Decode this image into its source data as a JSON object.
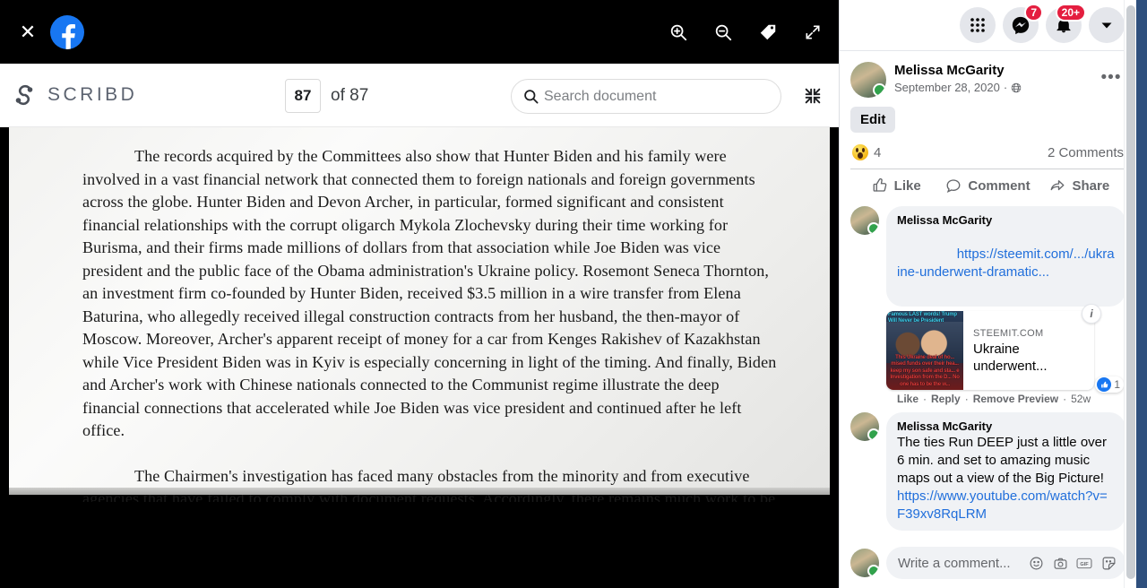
{
  "viewer": {
    "close_label": "✕",
    "brand_icon": "facebook-icon",
    "logo_text": "SCRIBD",
    "page_current": "87",
    "page_of": "of 87",
    "search_placeholder": "Search document",
    "icons": {
      "zoom_in": "zoom-in-icon",
      "zoom_out": "zoom-out-icon",
      "tag": "tag-icon",
      "expand": "expand-icon",
      "collapse": "collapse-icon"
    },
    "document": {
      "paragraphs": [
        "The records acquired by the Committees also show that Hunter Biden and his family were involved in a vast financial network that connected them to foreign nationals and foreign governments across the globe.  Hunter Biden and Devon Archer, in particular, formed significant and consistent financial relationships with the corrupt oligarch Mykola Zlochevsky during their time working for Burisma, and their firms made millions of dollars from that association while Joe Biden was vice president and the public face of the Obama administration's Ukraine policy.  Rosemont Seneca Thornton, an investment firm co-founded by Hunter Biden, received $3.5 million in a wire transfer from Elena Baturina, who allegedly received illegal construction contracts from her husband, the then-mayor of Moscow.  Moreover, Archer's apparent receipt of money for a car from Kenges Rakishev of Kazakhstan while Vice President Biden was in Kyiv is especially concerning in light of the timing.  And finally, Biden and Archer's work with Chinese nationals connected to the Communist regime illustrate the deep financial connections that accelerated while Joe Biden was vice president and continued after he left office.",
        "The Chairmen's investigation has faced many obstacles from the minority and from executive agencies that have failed to comply with document requests.  Accordingly, there remains much work to be done."
      ]
    }
  },
  "facebook": {
    "navbar": {
      "menu_icon": "grid-menu-icon",
      "messenger_icon": "messenger-icon",
      "messenger_badge": "7",
      "notifications_icon": "bell-icon",
      "notifications_badge": "20+",
      "account_icon": "chevron-down-icon"
    },
    "post": {
      "author": "Melissa McGarity",
      "date": "September 28, 2020",
      "privacy_icon": "globe-icon",
      "menu_icon": "ellipsis-icon",
      "edit_label": "Edit",
      "reaction_icon": "wow-emoji",
      "reaction_count": "4",
      "comments_count": "2 Comments",
      "actions": [
        {
          "label": "Like",
          "icon": "thumbs-up-icon"
        },
        {
          "label": "Comment",
          "icon": "comment-bubble-icon"
        },
        {
          "label": "Share",
          "icon": "share-arrow-icon"
        }
      ]
    },
    "comments": [
      {
        "author": "Melissa McGarity",
        "link_text": "https://steemit.com/.../ukraine-underwent-dramatic...",
        "preview": {
          "domain": "STEEMIT.COM",
          "title": "Ukraine underwent...",
          "info_icon": "info-icon",
          "thumb_caption_top": "Famous LAST words! Trump Will Never be President",
          "thumb_caption_bottom": "This Ukraine deal of ho... mised funds over their hea... keep my son safe and sta... e Investigation from the D... No one has to be the w..."
        },
        "meta": [
          "Like",
          "Reply",
          "Remove Preview",
          "52w"
        ],
        "like_count": "1",
        "like_icon": "thumbs-up-filled-icon"
      },
      {
        "author": "Melissa McGarity",
        "text": "The ties Run DEEP just a little over 6 min. and set to amazing music maps out a view of the Big Picture! ",
        "link_text": "https://www.youtube.com/watch?v=F39xv8RqLRM"
      }
    ],
    "composer": {
      "placeholder": "Write a comment...",
      "icons": [
        {
          "name": "emoji-icon",
          "glyph": "☺"
        },
        {
          "name": "camera-icon",
          "glyph": "▣"
        },
        {
          "name": "gif-icon",
          "glyph": "GIF"
        },
        {
          "name": "sticker-icon",
          "glyph": "◔"
        }
      ]
    }
  },
  "colors": {
    "fb_blue": "#1877f2",
    "badge_red": "#e41e3f",
    "link_blue": "#216fdb",
    "online_green": "#31a24c",
    "grey_bg": "#f0f2f5"
  }
}
